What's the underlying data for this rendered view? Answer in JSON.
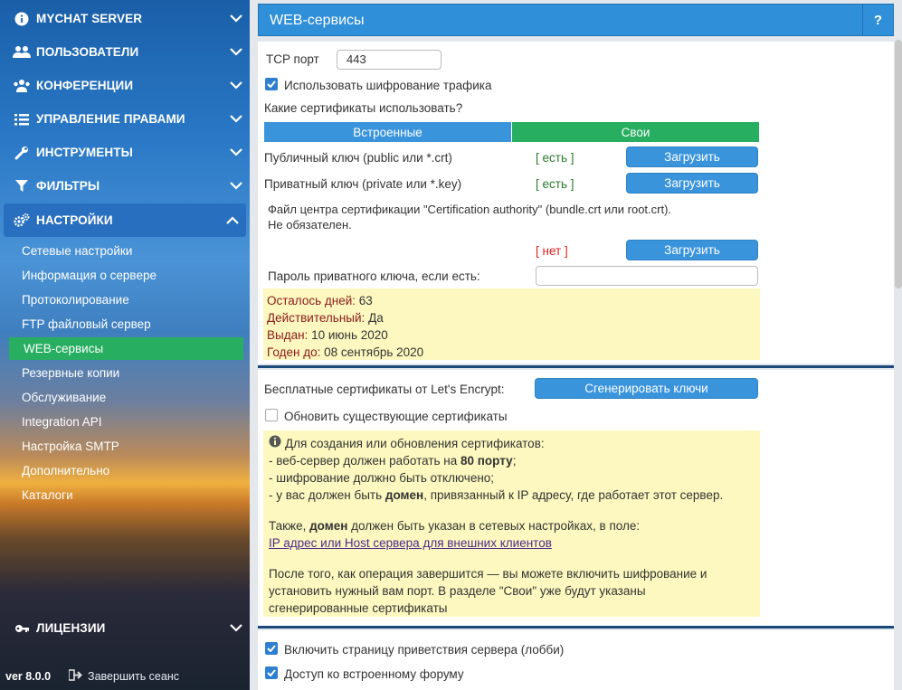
{
  "sidebar": {
    "items": [
      {
        "label": "MYCHAT SERVER",
        "icon": "info-icon"
      },
      {
        "label": "ПОЛЬЗОВАТЕЛИ",
        "icon": "users-icon"
      },
      {
        "label": "КОНФЕРЕНЦИИ",
        "icon": "conference-icon"
      },
      {
        "label": "УПРАВЛЕНИЕ ПРАВАМИ",
        "icon": "list-icon"
      },
      {
        "label": "ИНСТРУМЕНТЫ",
        "icon": "wrench-icon"
      },
      {
        "label": "ФИЛЬТРЫ",
        "icon": "filter-icon"
      },
      {
        "label": "НАСТРОЙКИ",
        "icon": "gears-icon"
      }
    ],
    "sub_items": [
      "Сетевые настройки",
      "Информация о сервере",
      "Протоколирование",
      "FTP файловый сервер",
      "WEB-сервисы",
      "Резервные копии",
      "Обслуживание",
      "Integration API",
      "Настройка SMTP",
      "Дополнительно",
      "Каталоги"
    ],
    "license": {
      "label": "ЛИЦЕНЗИИ",
      "icon": "key-icon"
    },
    "version": "ver 8.0.0",
    "logout_label": "Завершить сеанс"
  },
  "header": {
    "title": "WEB-сервисы",
    "help": "?"
  },
  "ssl": {
    "tcp_port_label": "TCP порт",
    "tcp_port_value": "443",
    "encrypt_label": "Использовать шифрование трафика",
    "which_certs_label": "Какие сертификаты использовать?",
    "toggle_builtin": "Встроенные",
    "toggle_own": "Свои",
    "public_key_label": "Публичный ключ (public или *.crt)",
    "public_key_status": "[ есть ]",
    "private_key_label": "Приватный ключ (private или *.key)",
    "private_key_status": "[ есть ]",
    "ca_label": "Файл центра сертификации \"Certification authority\" (bundle.crt или root.crt).",
    "ca_optional": "Не обязателен.",
    "ca_status": "[ нет ]",
    "upload_label": "Загрузить",
    "password_label": "Пароль приватного ключа, если есть:",
    "password_value": "",
    "cert_info": {
      "days_left_label": "Осталось дней:",
      "days_left": "63",
      "valid_label": "Действительный:",
      "valid": "Да",
      "issued_label": "Выдан:",
      "issued": "10 июнь 2020",
      "expires_label": "Годен до:",
      "expires": "08 сентябрь 2020"
    }
  },
  "letsencrypt": {
    "label": "Бесплатные сертификаты от Let's Encrypt:",
    "generate_button": "Сгенерировать ключи",
    "update_label": "Обновить существующие сертификаты",
    "info_title": "Для создания или обновления сертификатов:",
    "info_line1_a": "- веб-сервер должен работать на ",
    "info_line1_b": "80 порту",
    "info_line1_c": ";",
    "info_line2": "- шифрование должно быть отключено;",
    "info_line3_a": "- у вас должен быть ",
    "info_line3_b": "домен",
    "info_line3_c": ", привязанный к IP адресу, где работает этот сервер.",
    "info_also_a": "Также, ",
    "info_also_b": "домен",
    "info_also_c": " должен быть указан в сетевых настройках, в поле:",
    "info_link": "IP адрес или Host сервера для внешних клиентов",
    "info_after_1": "После того, как операция завершится — вы можете включить шифрование и",
    "info_after_2": "установить нужный вам порт. В разделе \"Свои\" уже будут указаны",
    "info_after_3": "сгенерированные сертификаты"
  },
  "bottom": {
    "lobby_label": "Включить страницу приветствия сервера (лобби)",
    "forum_label": "Доступ ко встроенному форуму"
  },
  "colors": {
    "accent": "#2f8fd8",
    "green": "#27ae60",
    "yellow": "#fdf8bf"
  }
}
